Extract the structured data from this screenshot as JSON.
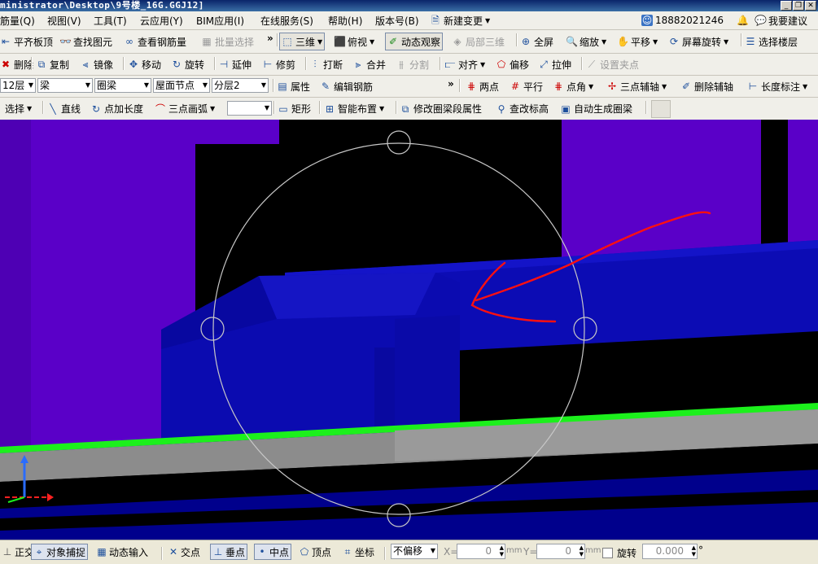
{
  "window": {
    "title": "ministrator\\Desktop\\9号楼_16G.GGJ12]",
    "controls": [
      "_",
      "❐",
      "✕"
    ]
  },
  "menubar": {
    "items": [
      "筋量(Q)",
      "视图(V)",
      "工具(T)",
      "云应用(Y)",
      "BIM应用(I)",
      "在线服务(S)",
      "帮助(H)",
      "版本号(B)",
      "新建变更",
      "18882021246",
      "我要建议"
    ]
  },
  "toolbar1": {
    "items": [
      "平齐板顶",
      "查找图元",
      "查看钢筋量",
      "批量选择",
      "三维",
      "俯视",
      "动态观察",
      "局部三维",
      "全屏",
      "缩放",
      "平移",
      "屏幕旋转",
      "选择楼层"
    ]
  },
  "toolbar2": {
    "items": [
      "删除",
      "复制",
      "镜像",
      "移动",
      "旋转",
      "延伸",
      "修剪",
      "打断",
      "合并",
      "分割",
      "对齐",
      "偏移",
      "拉伸",
      "设置夹点"
    ]
  },
  "toolbar3": {
    "floor": "12层",
    "element_type": "梁",
    "element_subtype": "圈梁",
    "node": "屋面节点",
    "layer": "分层2",
    "items": [
      "属性",
      "编辑钢筋",
      "两点",
      "平行",
      "点角",
      "三点辅轴",
      "删除辅轴",
      "长度标注"
    ]
  },
  "toolbar4": {
    "items": [
      "选择",
      "直线",
      "点加长度",
      "三点画弧",
      "矩形",
      "智能布置",
      "修改圈梁段属性",
      "查改标高",
      "自动生成圈梁"
    ],
    "blank_combo": ""
  },
  "viewport": {
    "colors": {
      "purple": "#5a00c8",
      "blue": "#0c0cb4",
      "dark_blue": "#00009c",
      "green_line": "#1cf01c",
      "gray": "#8c8c8c",
      "annotation": "#ff1010"
    }
  },
  "statusbar": {
    "items": [
      "正交",
      "对象捕捉",
      "动态输入",
      "交点",
      "垂点",
      "中点",
      "顶点",
      "坐标"
    ],
    "offset_mode": "不偏移",
    "x_label": "X=",
    "x_value": "0",
    "y_label": "Y=",
    "y_value": "0",
    "unit": "mm",
    "rotate_label": "旋转",
    "rotate_value": "0.000",
    "degree": "°"
  }
}
